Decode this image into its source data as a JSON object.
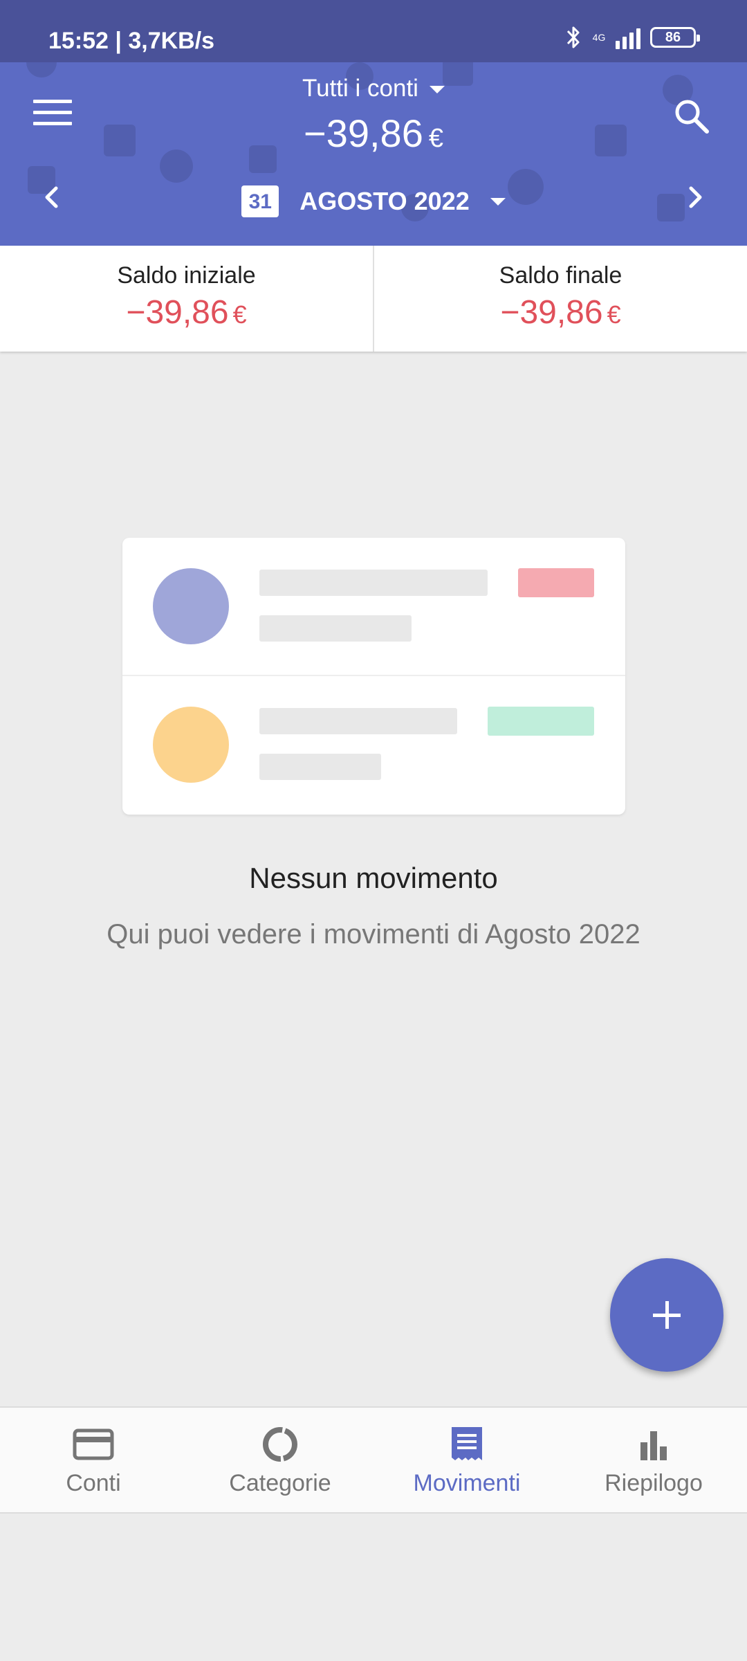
{
  "status_bar": {
    "time_speed": "15:52 | 3,7KB/s",
    "network": "4G",
    "battery": "86"
  },
  "header": {
    "account_selector": "Tutti i conti",
    "total_balance": "−39,86",
    "currency": "€",
    "month_label": "AGOSTO 2022",
    "calendar_day": "31"
  },
  "balances": {
    "initial_title": "Saldo iniziale",
    "initial_value": "−39,86",
    "final_title": "Saldo finale",
    "final_value": "−39,86",
    "currency": "€"
  },
  "empty_state": {
    "title": "Nessun movimento",
    "subtitle": "Qui puoi vedere i movimenti di Agosto 2022"
  },
  "bottom_nav": {
    "items": [
      {
        "label": "Conti",
        "icon": "credit-card-icon"
      },
      {
        "label": "Categorie",
        "icon": "donut-chart-icon"
      },
      {
        "label": "Movimenti",
        "icon": "receipt-icon",
        "active": true
      },
      {
        "label": "Riepilogo",
        "icon": "bar-chart-icon"
      }
    ]
  },
  "colors": {
    "primary": "#5c6bc4",
    "status_bar": "#4a5299",
    "negative": "#e0505a",
    "illustration_purple": "#9fa6d9",
    "illustration_orange": "#fcd38d",
    "illustration_red": "#f5aab1",
    "illustration_green": "#c0eedb"
  }
}
